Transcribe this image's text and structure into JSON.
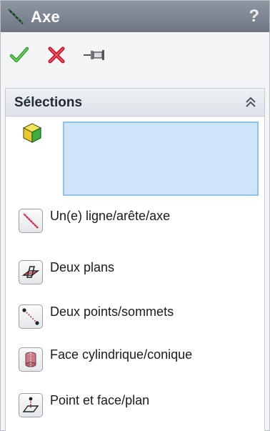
{
  "title": {
    "text": "Axe",
    "help": "?",
    "icon": "axis-icon"
  },
  "toolbar": {
    "ok_icon": "green-check-icon",
    "cancel_icon": "red-x-icon",
    "pin_icon": "pushpin-icon"
  },
  "selections": {
    "header": "Sélections",
    "collapse_icon": "double-chevron-up-icon",
    "entity_icon": "cube-icon",
    "selection_box_color": "#cce6f8",
    "options": [
      {
        "label": "Un(e) ligne/arête/axe",
        "icon": "line-edge-axis-icon"
      },
      {
        "label": "Deux plans",
        "icon": "two-planes-icon"
      },
      {
        "label": "Deux points/sommets",
        "icon": "two-points-icon"
      },
      {
        "label": "Face cylindrique/conique",
        "icon": "cylindrical-face-icon"
      },
      {
        "label": "Point et face/plan",
        "icon": "point-face-icon"
      }
    ]
  },
  "colors": {
    "titlebar": "#7f8794",
    "accent_red": "#c8102e",
    "accent_green": "#2e9b2e"
  }
}
